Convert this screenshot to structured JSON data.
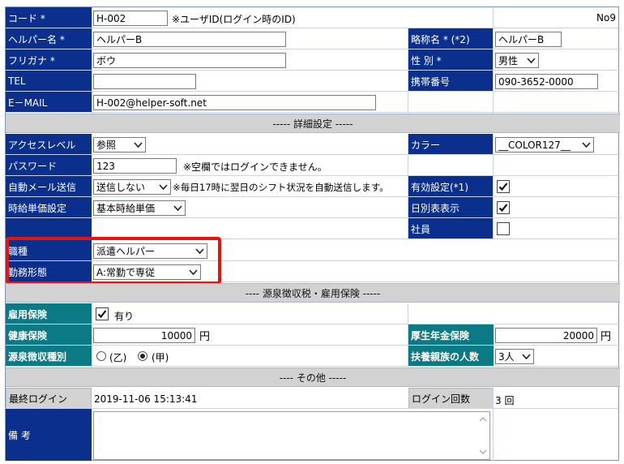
{
  "code": {
    "label": "コード *",
    "value": "H-002",
    "note": "※ユーザID(ログイン時のID)",
    "no": "No9"
  },
  "helper_name": {
    "label": "ヘルパー名 *",
    "value": "ヘルパーB"
  },
  "short_name": {
    "label": "略称名 * (*2)",
    "value": "ヘルパーB"
  },
  "furigana": {
    "label": "フリガナ *",
    "value": "ボウ"
  },
  "gender": {
    "label": "性 別 *",
    "value": "男性"
  },
  "tel": {
    "label": "TEL",
    "value": ""
  },
  "mobile": {
    "label": "携帯番号",
    "value": "090-3652-0000"
  },
  "email": {
    "label": "E－MAIL",
    "value": "H-002@helper-soft.net"
  },
  "section_detail": "----- 詳細設定 -----",
  "access": {
    "label": "アクセスレベル",
    "value": "参照"
  },
  "color": {
    "label": "カラー",
    "value": "__COLOR127__"
  },
  "password": {
    "label": "パスワード",
    "value": "123",
    "note": "※空欄ではログインできません。"
  },
  "automail": {
    "label": "自動メール送信",
    "value": "送信しない",
    "note": "※毎日17時に翌日のシフト状況を自動送信します。"
  },
  "valid": {
    "label": "有効設定(*1)",
    "checked": true
  },
  "hourly": {
    "label": "時給単価設定",
    "value": "基本時給単価"
  },
  "daily_table": {
    "label": "日別表表示",
    "checked": true
  },
  "employee": {
    "label": "社員",
    "checked": false
  },
  "job": {
    "label": "職種",
    "value": "派遣ヘルパー"
  },
  "work_style": {
    "label": "勤務形態",
    "value": "A:常勤で専従"
  },
  "section_tax": "---- 源泉徴収税・雇用保険 -----",
  "employment_ins": {
    "label": "雇用保険",
    "checkbox_label": "有り",
    "checked": true
  },
  "health_ins": {
    "label": "健康保険",
    "value": "10000",
    "unit": "円"
  },
  "pension": {
    "label": "厚生年金保険",
    "value": "20000",
    "unit": "円"
  },
  "withholding": {
    "label": "源泉徴収種別",
    "opt1": "(乙)",
    "opt2": "(甲)",
    "selected": "(甲)"
  },
  "dependents": {
    "label": "扶養親族の人数",
    "value": "3人"
  },
  "section_other": "---- その他 -----",
  "last_login": {
    "label": "最終ログイン",
    "value": "2019-11-06 15:13:41"
  },
  "login_count": {
    "label": "ログイン回数",
    "value": "3 回"
  },
  "remarks": {
    "label": "備 考",
    "value": ""
  }
}
